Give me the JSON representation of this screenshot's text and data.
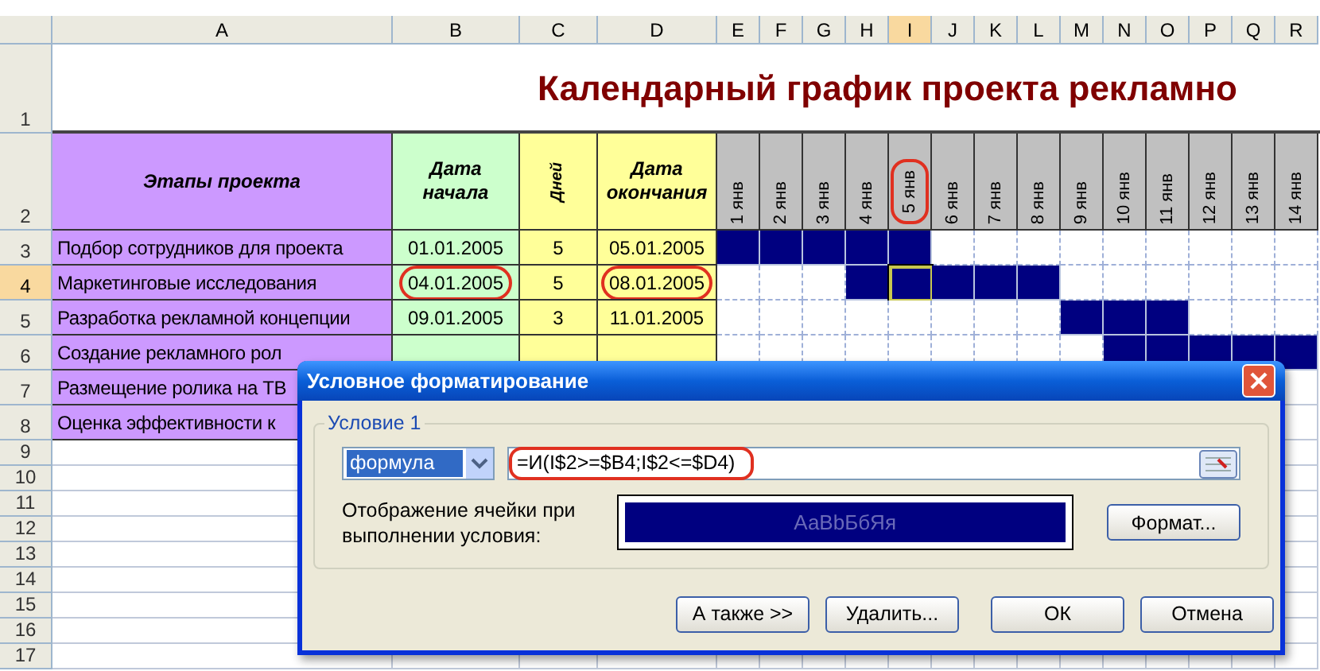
{
  "column_headers": [
    {
      "label": "A",
      "selected": false
    },
    {
      "label": "B",
      "selected": false
    },
    {
      "label": "C",
      "selected": false
    },
    {
      "label": "D",
      "selected": false
    },
    {
      "label": "E",
      "selected": false
    },
    {
      "label": "F",
      "selected": false
    },
    {
      "label": "G",
      "selected": false
    },
    {
      "label": "H",
      "selected": false
    },
    {
      "label": "I",
      "selected": true
    },
    {
      "label": "J",
      "selected": false
    },
    {
      "label": "K",
      "selected": false
    },
    {
      "label": "L",
      "selected": false
    },
    {
      "label": "M",
      "selected": false
    },
    {
      "label": "N",
      "selected": false
    },
    {
      "label": "O",
      "selected": false
    },
    {
      "label": "P",
      "selected": false
    },
    {
      "label": "Q",
      "selected": false
    },
    {
      "label": "R",
      "selected": false
    }
  ],
  "rows": [
    {
      "number": "1",
      "selected": false,
      "kind": "title",
      "title": "Календарный график проекта рекламно"
    },
    {
      "number": "2",
      "selected": false,
      "kind": "header",
      "stage": "Этапы проекта",
      "start": "Дата начала",
      "duration": "Дней",
      "end": "Дата окончания",
      "days": [
        {
          "label": "1 янв",
          "circled": false
        },
        {
          "label": "2 янв",
          "circled": false
        },
        {
          "label": "3 янв",
          "circled": false
        },
        {
          "label": "4 янв",
          "circled": false
        },
        {
          "label": "5 янв",
          "circled": true
        },
        {
          "label": "6 янв",
          "circled": false
        },
        {
          "label": "7 янв",
          "circled": false
        },
        {
          "label": "8 янв",
          "circled": false
        },
        {
          "label": "9 янв",
          "circled": false
        },
        {
          "label": "10 янв",
          "circled": false
        },
        {
          "label": "11 янв",
          "circled": false
        },
        {
          "label": "12 янв",
          "circled": false
        },
        {
          "label": "13 янв",
          "circled": false
        },
        {
          "label": "14 янв",
          "circled": false
        }
      ]
    },
    {
      "number": "3",
      "selected": false,
      "kind": "task",
      "task": "Подбор сотрудников для проекта",
      "start": "01.01.2005",
      "start_circled": false,
      "duration": "5",
      "end": "05.01.2005",
      "end_circled": false,
      "days": [
        {
          "filled": true,
          "selected": false
        },
        {
          "filled": true,
          "selected": false
        },
        {
          "filled": true,
          "selected": false
        },
        {
          "filled": true,
          "selected": false
        },
        {
          "filled": true,
          "selected": false
        },
        {
          "filled": false,
          "selected": false
        },
        {
          "filled": false,
          "selected": false
        },
        {
          "filled": false,
          "selected": false
        },
        {
          "filled": false,
          "selected": false
        },
        {
          "filled": false,
          "selected": false
        },
        {
          "filled": false,
          "selected": false
        },
        {
          "filled": false,
          "selected": false
        },
        {
          "filled": false,
          "selected": false
        },
        {
          "filled": false,
          "selected": false
        }
      ]
    },
    {
      "number": "4",
      "selected": true,
      "kind": "task",
      "task": "Маркетинговые исследования",
      "start": "04.01.2005",
      "start_circled": true,
      "duration": "5",
      "end": "08.01.2005",
      "end_circled": true,
      "days": [
        {
          "filled": false,
          "selected": false
        },
        {
          "filled": false,
          "selected": false
        },
        {
          "filled": false,
          "selected": false
        },
        {
          "filled": true,
          "selected": false
        },
        {
          "filled": true,
          "selected": true
        },
        {
          "filled": true,
          "selected": false
        },
        {
          "filled": true,
          "selected": false
        },
        {
          "filled": true,
          "selected": false
        },
        {
          "filled": false,
          "selected": false
        },
        {
          "filled": false,
          "selected": false
        },
        {
          "filled": false,
          "selected": false
        },
        {
          "filled": false,
          "selected": false
        },
        {
          "filled": false,
          "selected": false
        },
        {
          "filled": false,
          "selected": false
        }
      ]
    },
    {
      "number": "5",
      "selected": false,
      "kind": "task",
      "task": "Разработка рекламной концепции",
      "start": "09.01.2005",
      "start_circled": false,
      "duration": "3",
      "end": "11.01.2005",
      "end_circled": false,
      "days": [
        {
          "filled": false,
          "selected": false
        },
        {
          "filled": false,
          "selected": false
        },
        {
          "filled": false,
          "selected": false
        },
        {
          "filled": false,
          "selected": false
        },
        {
          "filled": false,
          "selected": false
        },
        {
          "filled": false,
          "selected": false
        },
        {
          "filled": false,
          "selected": false
        },
        {
          "filled": false,
          "selected": false
        },
        {
          "filled": true,
          "selected": false
        },
        {
          "filled": true,
          "selected": false
        },
        {
          "filled": true,
          "selected": false
        },
        {
          "filled": false,
          "selected": false
        },
        {
          "filled": false,
          "selected": false
        },
        {
          "filled": false,
          "selected": false
        }
      ]
    },
    {
      "number": "6",
      "selected": false,
      "kind": "task",
      "task": "Создание рекламного рол",
      "days": [
        {
          "filled": false,
          "selected": false
        },
        {
          "filled": false,
          "selected": false
        },
        {
          "filled": false,
          "selected": false
        },
        {
          "filled": false,
          "selected": false
        },
        {
          "filled": false,
          "selected": false
        },
        {
          "filled": false,
          "selected": false
        },
        {
          "filled": false,
          "selected": false
        },
        {
          "filled": false,
          "selected": false
        },
        {
          "filled": false,
          "selected": false
        },
        {
          "filled": true,
          "selected": false
        },
        {
          "filled": true,
          "selected": false
        },
        {
          "filled": true,
          "selected": false
        },
        {
          "filled": true,
          "selected": false
        },
        {
          "filled": true,
          "selected": false
        }
      ]
    },
    {
      "number": "7",
      "selected": false,
      "kind": "task",
      "task": "Размещение ролика на ТВ"
    },
    {
      "number": "8",
      "selected": false,
      "kind": "task",
      "task": "Оценка эффективности к"
    },
    {
      "number": "9",
      "selected": false,
      "kind": "blank"
    },
    {
      "number": "10",
      "selected": false,
      "kind": "blank"
    },
    {
      "number": "11",
      "selected": false,
      "kind": "blank"
    },
    {
      "number": "12",
      "selected": false,
      "kind": "blank"
    },
    {
      "number": "13",
      "selected": false,
      "kind": "blank"
    },
    {
      "number": "14",
      "selected": false,
      "kind": "blank"
    },
    {
      "number": "15",
      "selected": false,
      "kind": "blank"
    },
    {
      "number": "16",
      "selected": false,
      "kind": "blank"
    },
    {
      "number": "17",
      "selected": false,
      "kind": "blank"
    }
  ],
  "dialog": {
    "title": "Условное форматирование",
    "group_label": "Условие 1",
    "condition_type": "формула",
    "formula": "=И(I$2>=$B4;I$2<=$D4)",
    "formula_circled": true,
    "preview_label": "Отображение ячейки при выполнении условия:",
    "preview_text": "АаBbБбЯя",
    "format_button": "Формат...",
    "buttons": [
      "А также >>",
      "Удалить...",
      "ОК",
      "Отмена"
    ]
  }
}
